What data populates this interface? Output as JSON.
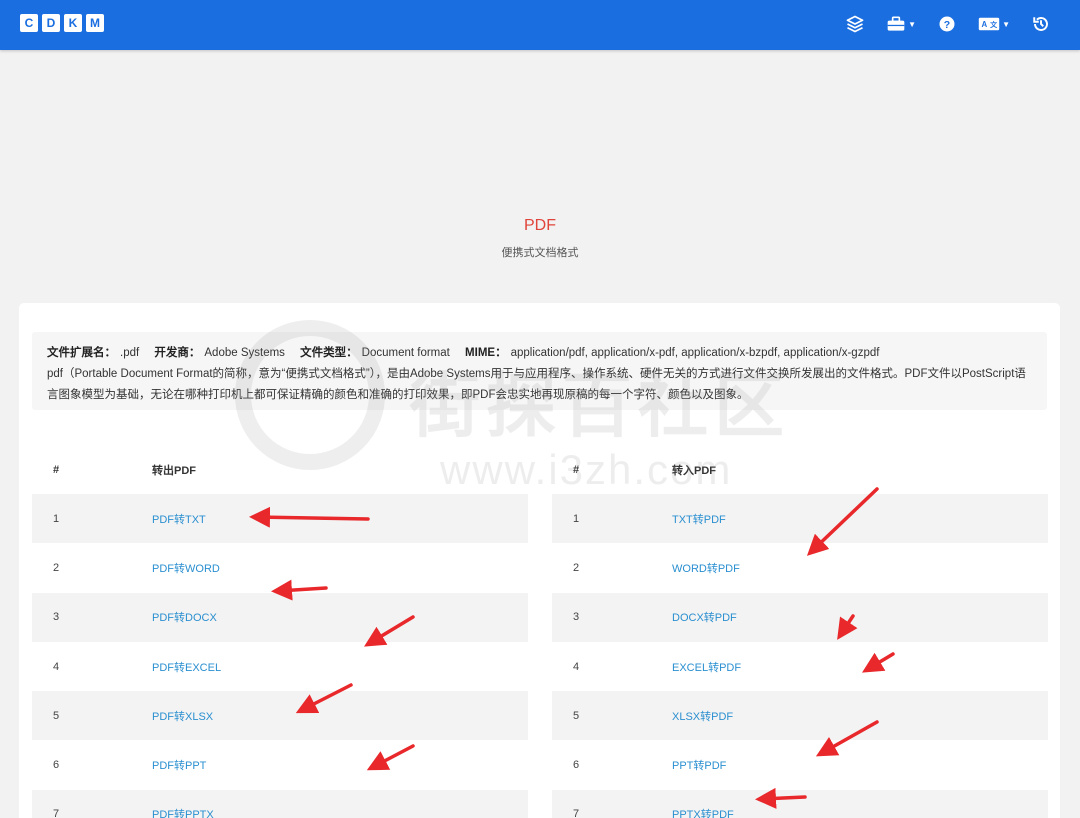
{
  "header": {
    "logo_letters": [
      "C",
      "D",
      "K",
      "M"
    ],
    "icons": [
      "layers-icon",
      "toolbox-icon",
      "help-icon",
      "translate-icon",
      "history-icon"
    ],
    "accent_color": "#1a6ee0"
  },
  "hero": {
    "title": "PDF",
    "subtitle": "便携式文档格式"
  },
  "info": {
    "ext_label": "文件扩展名：",
    "ext_value": ".pdf",
    "dev_label": "开发商：",
    "dev_value": "Adobe Systems",
    "type_label": "文件类型：",
    "type_value": "Document format",
    "mime_label": "MIME：",
    "mime_value": "application/pdf, application/x-pdf, application/x-bzpdf, application/x-gzpdf",
    "description": "pdf（Portable Document Format的简称，意为“便携式文档格式”），是由Adobe Systems用于与应用程序、操作系统、硬件无关的方式进行文件交换所发展出的文件格式。PDF文件以PostScript语言图象模型为基础，无论在哪种打印机上都可保证精确的颜色和准确的打印效果，即PDF会忠实地再现原稿的每一个字符、颜色以及图象。"
  },
  "tables": {
    "export": {
      "col_num": "#",
      "col_name": "转出PDF",
      "rows": [
        {
          "num": "1",
          "label": "PDF转TXT"
        },
        {
          "num": "2",
          "label": "PDF转WORD"
        },
        {
          "num": "3",
          "label": "PDF转DOCX"
        },
        {
          "num": "4",
          "label": "PDF转EXCEL"
        },
        {
          "num": "5",
          "label": "PDF转XLSX"
        },
        {
          "num": "6",
          "label": "PDF转PPT"
        },
        {
          "num": "7",
          "label": "PDF转PPTX"
        }
      ]
    },
    "import": {
      "col_num": "#",
      "col_name": "转入PDF",
      "rows": [
        {
          "num": "1",
          "label": "TXT转PDF"
        },
        {
          "num": "2",
          "label": "WORD转PDF"
        },
        {
          "num": "3",
          "label": "DOCX转PDF"
        },
        {
          "num": "4",
          "label": "EXCEL转PDF"
        },
        {
          "num": "5",
          "label": "XLSX转PDF"
        },
        {
          "num": "6",
          "label": "PPT转PDF"
        },
        {
          "num": "7",
          "label": "PPTX转PDF"
        }
      ]
    }
  },
  "watermark": {
    "title": "街探百社区",
    "url": "www.i3zh.com"
  },
  "annotation_color": "#e8282b"
}
